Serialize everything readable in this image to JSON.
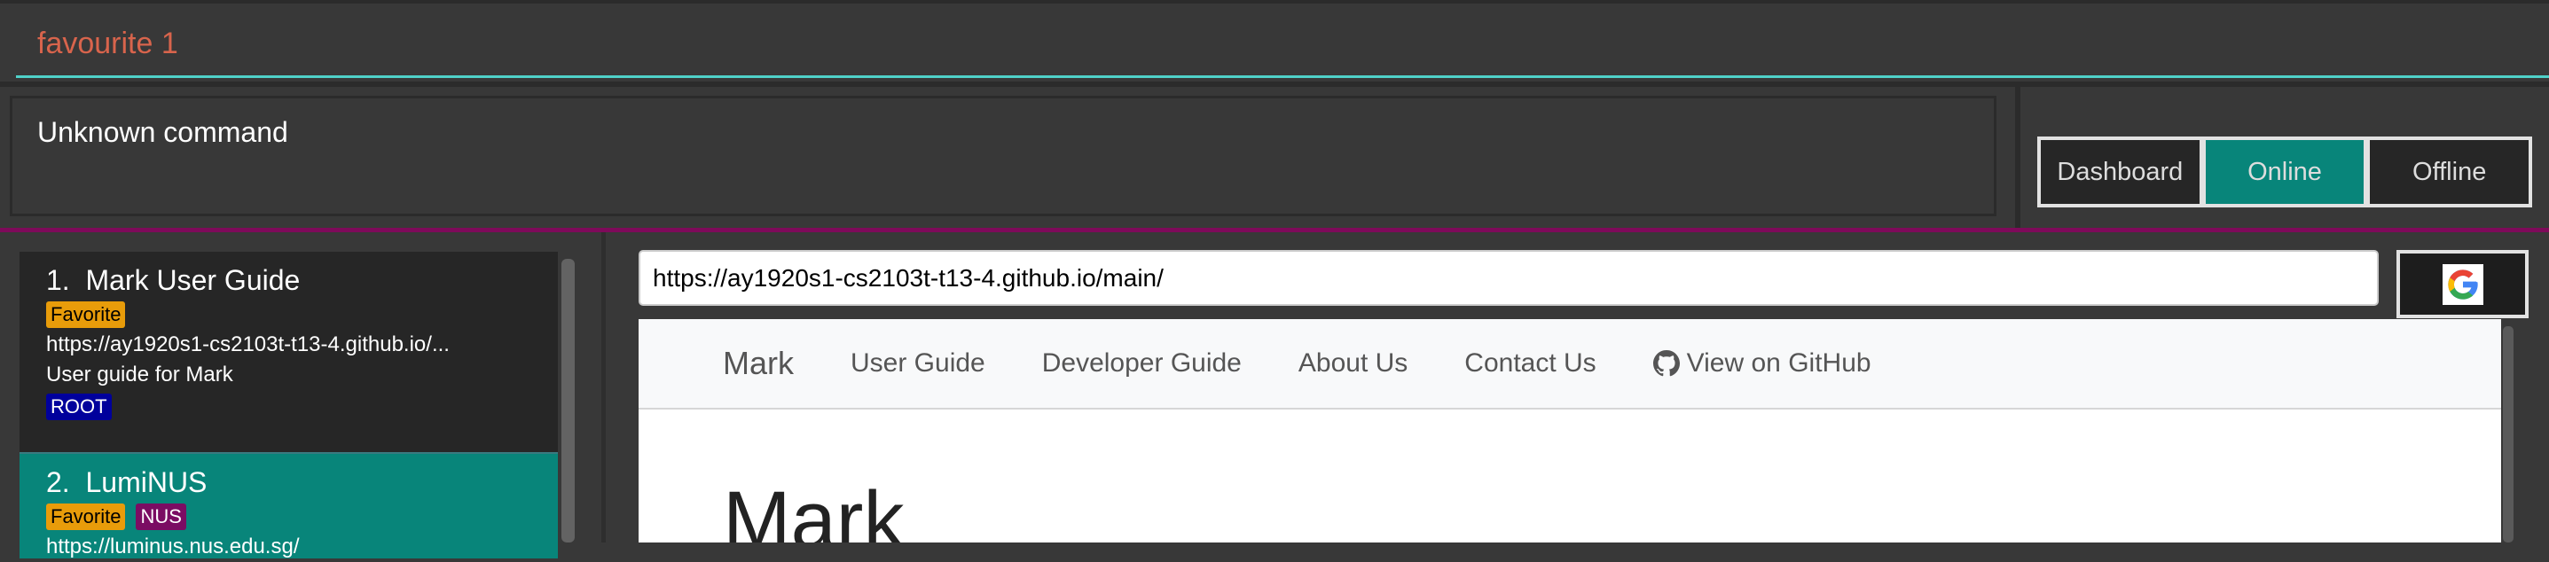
{
  "command_box": {
    "value": "favourite 1"
  },
  "result_box": {
    "text": "Unknown command"
  },
  "mode_buttons": [
    {
      "label": "Dashboard",
      "active": false
    },
    {
      "label": "Online",
      "active": true
    },
    {
      "label": "Offline",
      "active": false
    }
  ],
  "bookmarks": [
    {
      "index": "1.",
      "name": "Mark User Guide",
      "tags_top": [
        "Favorite"
      ],
      "url": "https://ay1920s1-cs2103t-t13-4.github.io/...",
      "description": "User guide for Mark",
      "folder": "ROOT"
    },
    {
      "index": "2.",
      "name": "LumiNUS",
      "tags_top": [
        "Favorite",
        "NUS"
      ],
      "url": "https://luminus.nus.edu.sg/"
    }
  ],
  "browser": {
    "url": "https://ay1920s1-cs2103t-t13-4.github.io/main/",
    "search_icon": "google-icon",
    "nav": {
      "brand": "Mark",
      "links": [
        "User Guide",
        "Developer Guide",
        "About Us",
        "Contact Us",
        "View on GitHub"
      ]
    },
    "heading": "Mark"
  },
  "colors": {
    "accent_teal": "#08857a",
    "command_text": "#d8644c",
    "favorite_tag": "#e89c0a",
    "root_tag": "#00009c",
    "nus_tag": "#7b0c63",
    "divider": "#7e0a5a"
  }
}
